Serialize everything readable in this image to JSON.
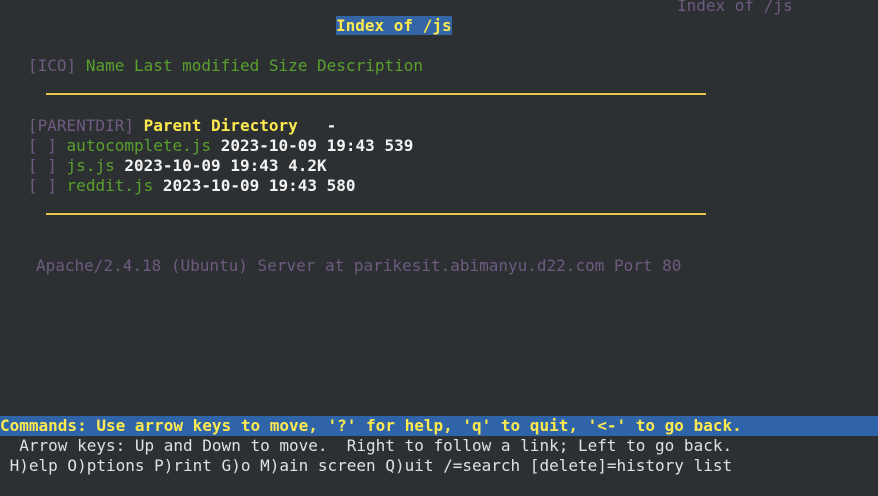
{
  "top_right_title": "Index of /js",
  "heading": "Index of /js",
  "columns": {
    "ico": "[ICO]",
    "name": "Name",
    "last_modified": "Last modified",
    "size": "Size",
    "description": "Description"
  },
  "parent": {
    "icon": "[PARENTDIR]",
    "name": "Parent Directory",
    "size": "-"
  },
  "files": [
    {
      "icon": "[ ]",
      "name": "autocomplete.js",
      "modified": "2023-10-09 19:43",
      "size": "539"
    },
    {
      "icon": "[ ]",
      "name": "js.js",
      "modified": "2023-10-09 19:43",
      "size": "4.2K"
    },
    {
      "icon": "[ ]",
      "name": "reddit.js",
      "modified": "2023-10-09 19:43",
      "size": "580"
    }
  ],
  "server_signature": "Apache/2.4.18 (Ubuntu) Server at parikesit.abimanyu.d22.com Port 80",
  "status": {
    "commands": "Commands: Use arrow keys to move, '?' for help, 'q' to quit, '<-' to go back.",
    "arrow_help": "  Arrow keys: Up and Down to move.  Right to follow a link; Left to go back.",
    "menu_help": " H)elp O)ptions P)rint G)o M)ain screen Q)uit /=search [delete]=history list"
  },
  "colors": {
    "background": "#2c3033",
    "link": "#5aa02c",
    "highlight": "#fce94f",
    "status_bar": "#2f64a8",
    "rule": "#e6c84a"
  }
}
